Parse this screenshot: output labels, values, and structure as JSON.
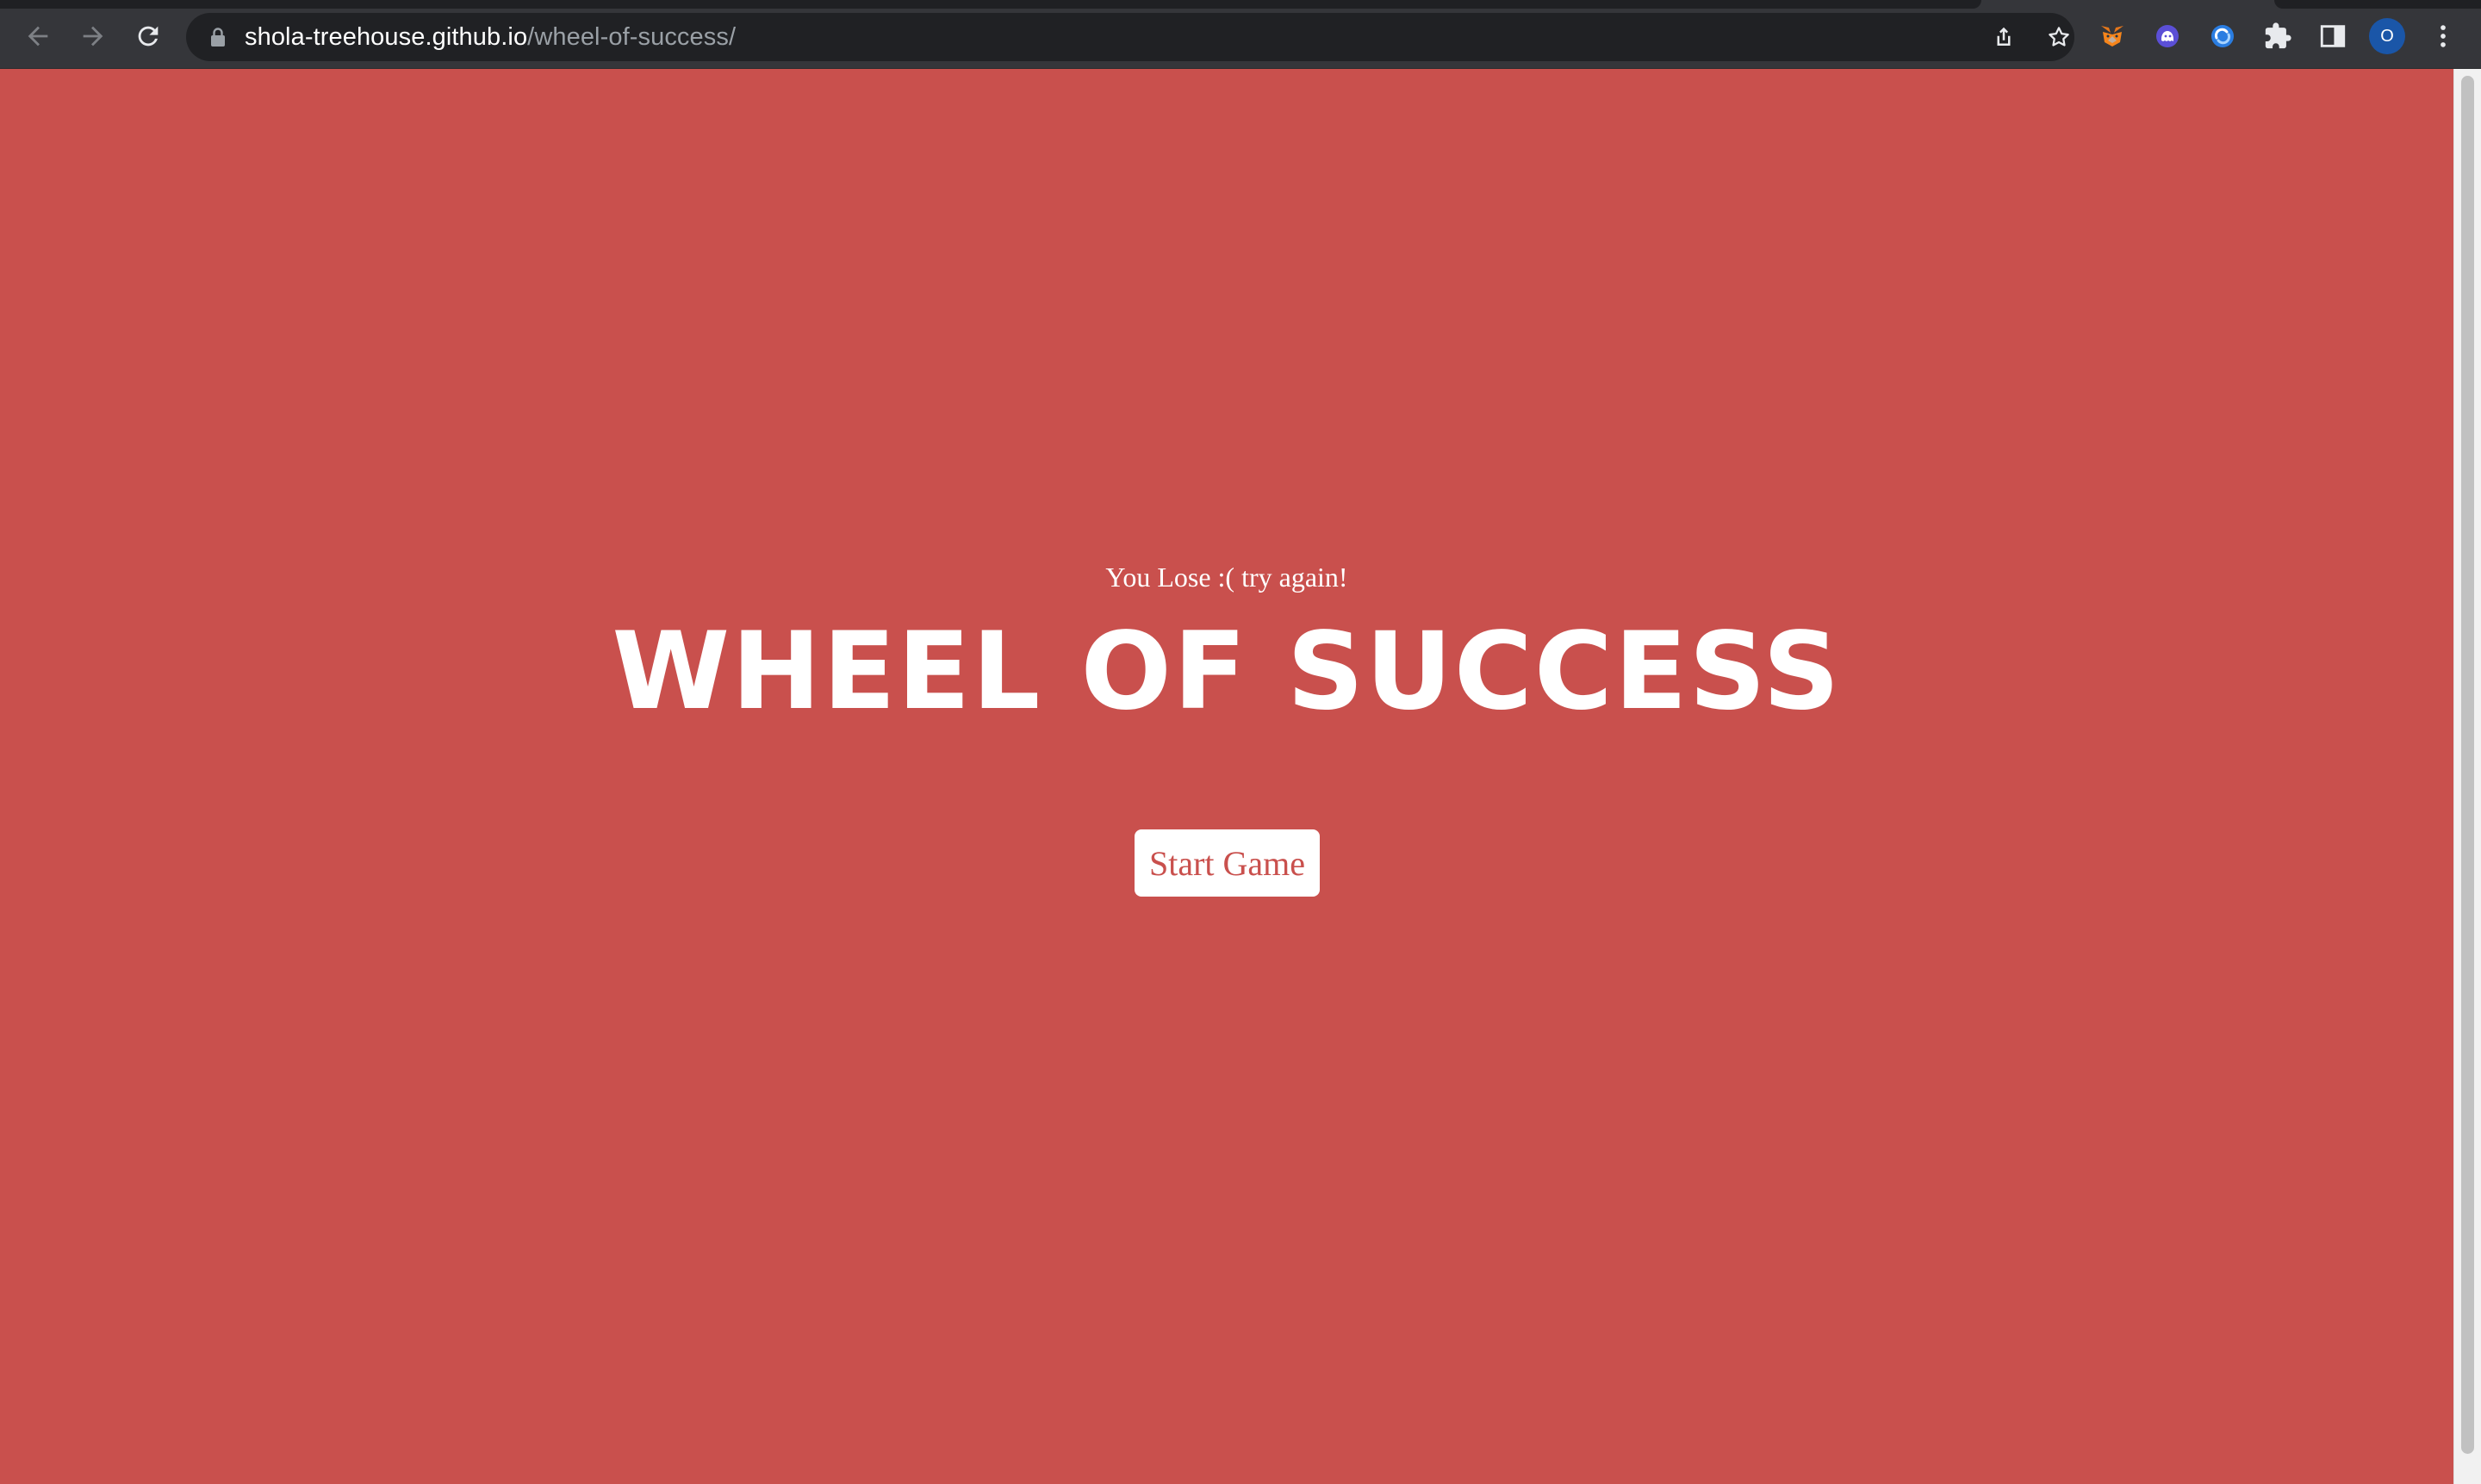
{
  "browser": {
    "url_host": "shola-treehouse.github.io",
    "url_path": "/wheel-of-success/",
    "avatar_initial": "O",
    "icons": {
      "back": "arrow-left-icon",
      "forward": "arrow-right-icon",
      "reload": "reload-icon",
      "lock": "lock-icon",
      "share": "share-icon",
      "bookmark": "star-icon",
      "extensions": [
        "metamask-fox-icon",
        "ghost-extension-icon",
        "blue-swirl-extension-icon",
        "puzzle-piece-icon"
      ],
      "side_panel": "side-panel-icon",
      "menu": "kebab-menu-icon"
    }
  },
  "page": {
    "background_color": "#c9504d",
    "message": "You Lose :( try again!",
    "title": "WHEEL OF SUCCESS",
    "start_button_label": "Start Game"
  }
}
